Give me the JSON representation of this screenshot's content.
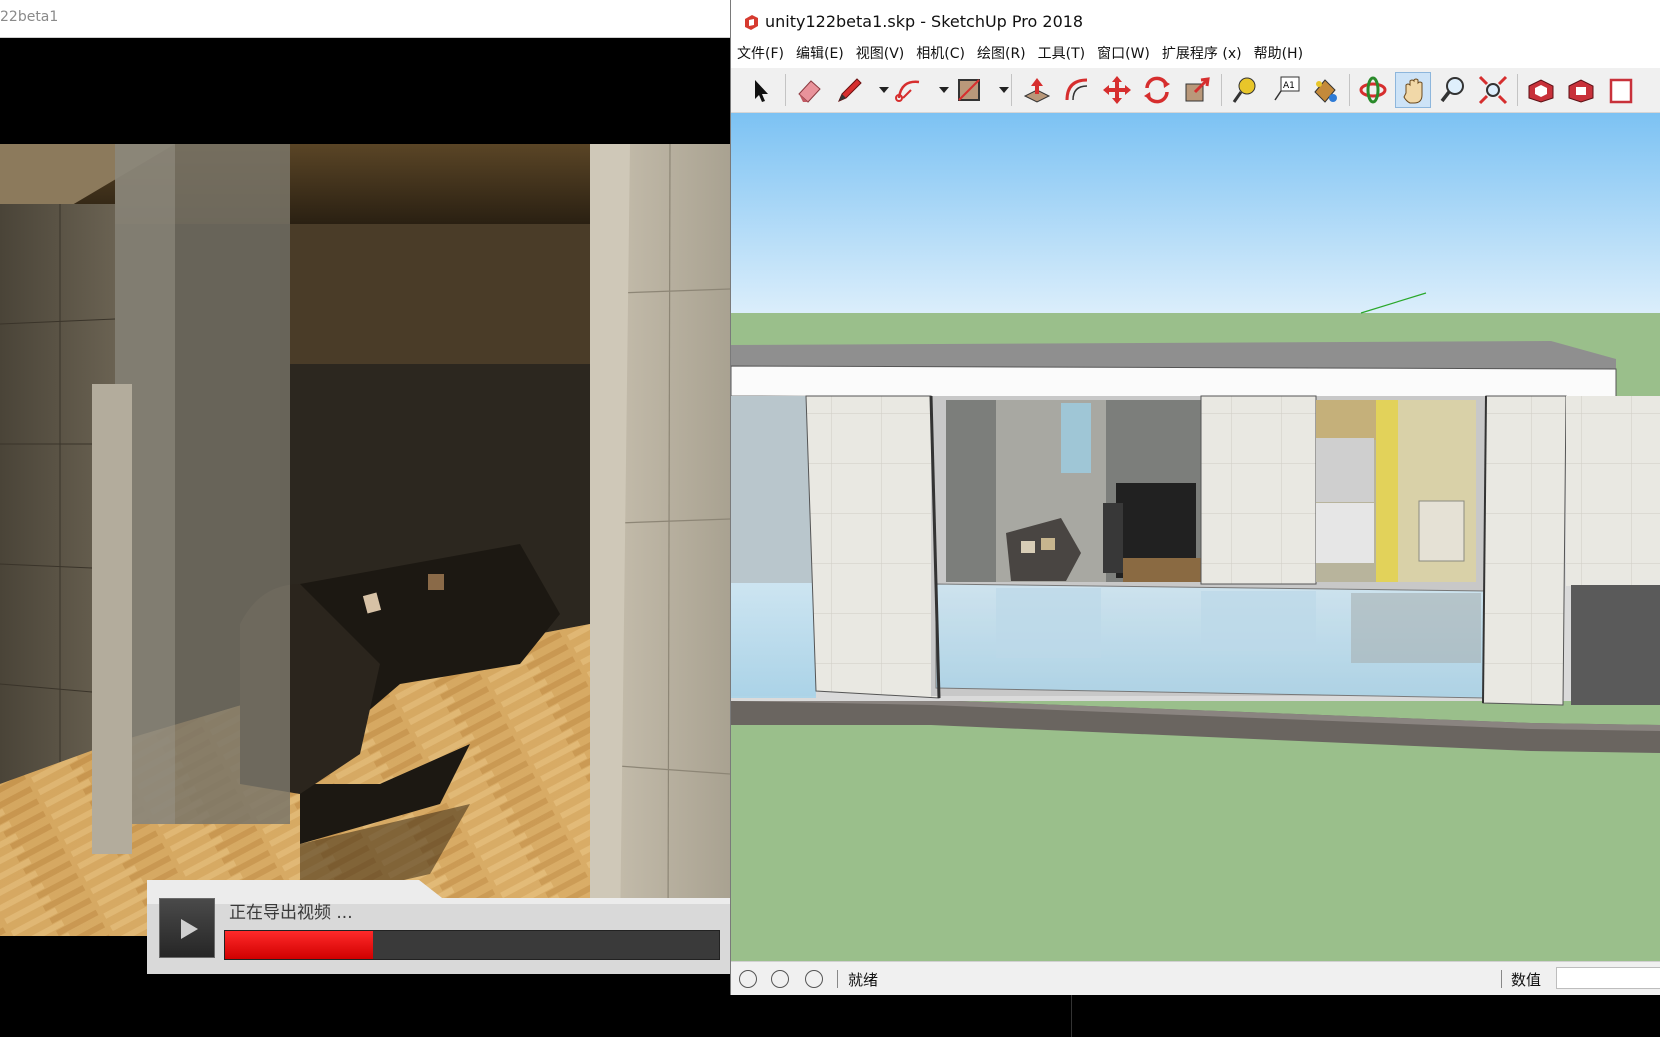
{
  "left_window": {
    "title": "22beta1"
  },
  "export": {
    "status_text": "正在导出视频 ...",
    "progress_percent": 30
  },
  "sketchup": {
    "title": "unity122beta1.skp - SketchUp Pro 2018",
    "menu": [
      "文件(F)",
      "编辑(E)",
      "视图(V)",
      "相机(C)",
      "绘图(R)",
      "工具(T)",
      "窗口(W)",
      "扩展程序 (x)",
      "帮助(H)"
    ],
    "toolbar": [
      "select-tool",
      "eraser-tool",
      "pencil-tool",
      "arc-tool",
      "rectangle-tool",
      "push-pull-tool",
      "offset-tool",
      "move-tool",
      "rotate-tool",
      "scale-tool",
      "tape-measure-tool",
      "text-tool",
      "paint-bucket-tool",
      "orbit-tool",
      "pan-tool",
      "zoom-tool",
      "zoom-extents-tool",
      "warehouse-tool",
      "extension-warehouse-tool",
      "layout-tool"
    ],
    "active_tool": "pan-tool",
    "status_text": "就绪",
    "value_label": "数值",
    "value": ""
  },
  "colors": {
    "sky_top": "#7cc2f3",
    "sky_bottom": "#d9eefc",
    "ground": "#9abf8b",
    "progress": "#e60000"
  }
}
